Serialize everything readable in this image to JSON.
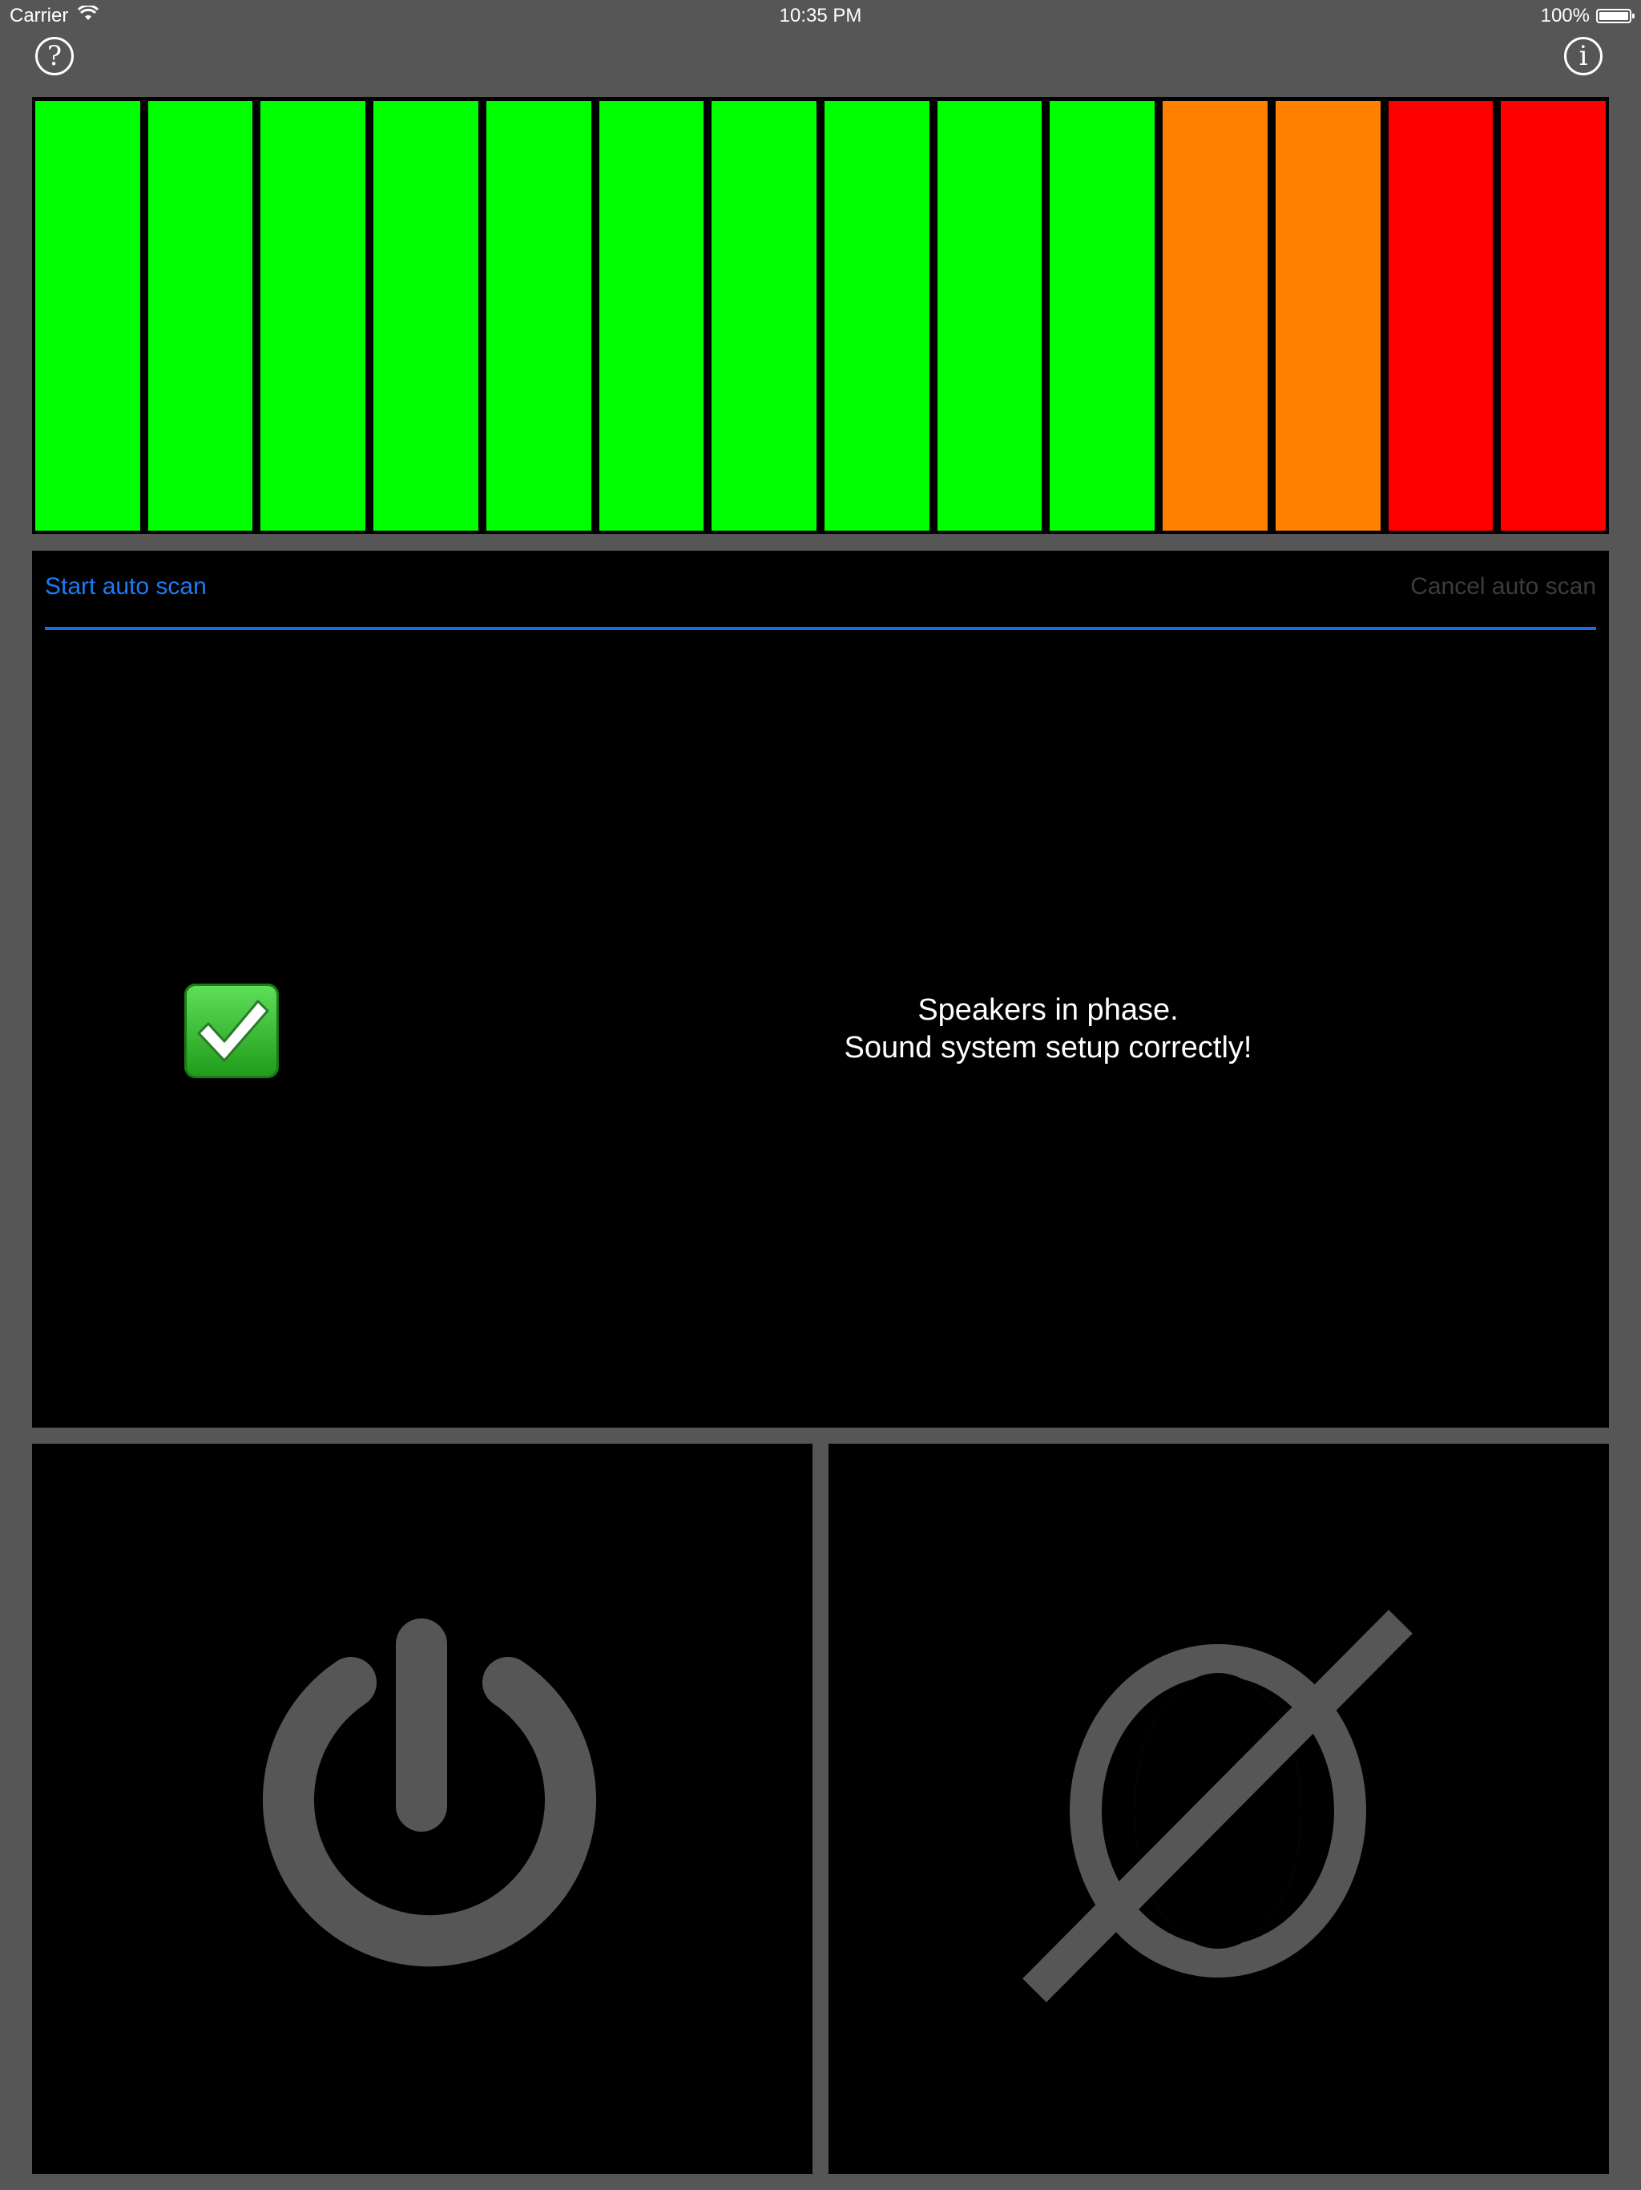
{
  "status_bar": {
    "carrier": "Carrier",
    "time": "10:35 PM",
    "battery": "100%"
  },
  "toolbar": {
    "help_icon": "question-circle-icon",
    "help_label": "?",
    "info_icon": "info-circle-icon",
    "info_label": "i"
  },
  "level_meter": {
    "segment_count": 14,
    "lit_segments": 14,
    "segment_colors": [
      "#00ff00",
      "#00ff00",
      "#00ff00",
      "#00ff00",
      "#00ff00",
      "#00ff00",
      "#00ff00",
      "#00ff00",
      "#00ff00",
      "#00ff00",
      "#ff8000",
      "#ff8000",
      "#ff0000",
      "#ff0000"
    ]
  },
  "scan": {
    "start_label": "Start auto scan",
    "cancel_label": "Cancel auto scan",
    "progress": 1.0,
    "accent_color": "#1a7cf5"
  },
  "result": {
    "icon": "check-mark-icon",
    "line1": "Speakers in phase.",
    "line2": "Sound system setup correctly!"
  },
  "controls": {
    "power_icon": "power-icon",
    "phase_icon": "phase-invert-icon",
    "icon_color": "#565656"
  }
}
